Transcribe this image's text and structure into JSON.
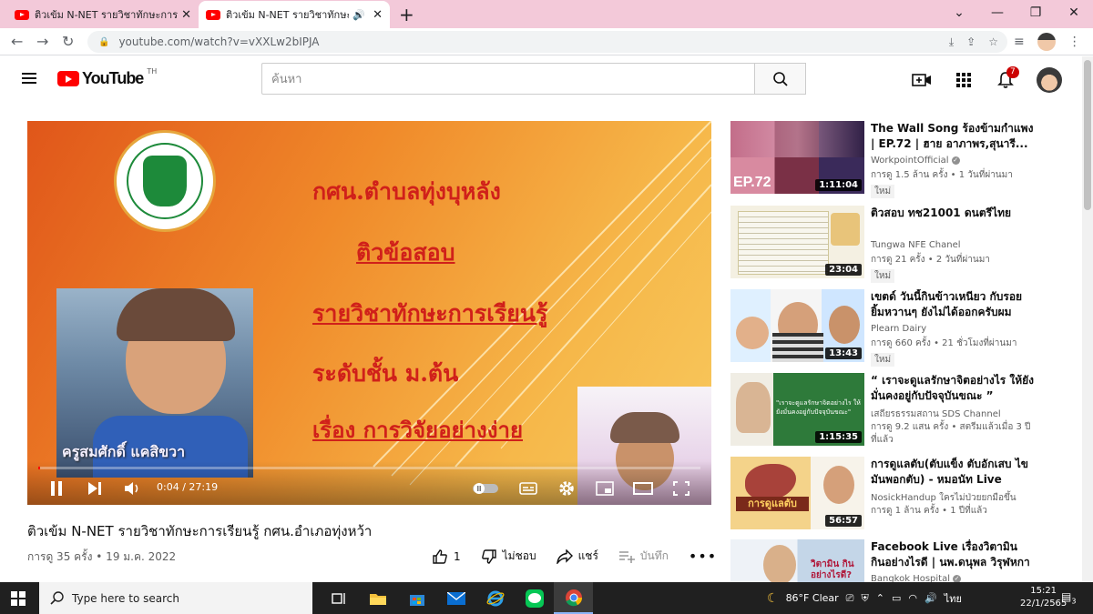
{
  "browser": {
    "tabs": [
      {
        "title": "ติวเข้ม N-NET รายวิชาทักษะการเรียนรู้",
        "active": false
      },
      {
        "title": "ติวเข้ม N-NET รายวิชาทักษะการเรี",
        "active": true
      }
    ],
    "url": "youtube.com/watch?v=vXXLw2bIPJA"
  },
  "youtube": {
    "logo_text": "YouTube",
    "country_code": "TH",
    "search_placeholder": "ค้นหา",
    "notification_count": "7"
  },
  "player": {
    "slide_lines": [
      "กศน.ตำบลทุ่งบุหลัง",
      "ติวข้อสอบ",
      "รายวิชาทักษะการเรียนรู้",
      "ระดับชั้น ม.ต้น",
      "เรื่อง การวิจัยอย่างง่าย"
    ],
    "presenter_name": "ครูสมศักดิ์ แคสิขวา",
    "time": "0:04 / 27:19",
    "progress": 0.0024
  },
  "video": {
    "title": "ติวเข้ม N-NET รายวิชาทักษะการเรียนรู้ กศน.อำเภอทุ่งหว้า",
    "meta": "การดู 35 ครั้ง • 19 ม.ค. 2022",
    "like_count": "1",
    "dislike_label": "ไม่ชอบ",
    "share_label": "แชร์",
    "save_label": "บันทึก"
  },
  "recommendations": [
    {
      "title": "The Wall Song ร้องข้ามกำแพง | EP.72 | ฮาย อาภาพร,สุนารี...",
      "channel": "WorkpointOfficial",
      "verified": true,
      "views": "การดู 1.5 ล้าน ครั้ง • 1 วันที่ผ่านมา",
      "badge": "ใหม่",
      "duration": "1:11:04",
      "thumb_text": "EP.72"
    },
    {
      "title": "ติวสอบ ทช21001 ดนตรีไทย",
      "channel": "Tungwa NFE Chanel",
      "verified": false,
      "views": "การดู 21 ครั้ง • 2 วันที่ผ่านมา",
      "badge": "ใหม่",
      "duration": "23:04",
      "thumb_text": ""
    },
    {
      "title": "เขตด์ วันนี้กินข้าวเหนียว กับรอยยิ้มหวานๆ ยังไม่ได้ออกครับผม",
      "channel": "Plearn Dairy",
      "verified": false,
      "views": "การดู 660 ครั้ง • 21 ชั่วโมงที่ผ่านมา",
      "badge": "ใหม่",
      "duration": "13:43",
      "thumb_text": ""
    },
    {
      "title": "“ เราจะดูแลรักษาจิตอย่างไร ให้ยังมั่นคงอยู่กับปัจจุบันขณะ ”",
      "channel": "เสถียรธรรมสถาน SDS Channel",
      "verified": false,
      "views": "การดู 9.2 แสน ครั้ง • สตรีมแล้วเมื่อ 3 ปีที่แล้ว",
      "badge": "",
      "duration": "1:15:35",
      "thumb_text": "\"เราจะดูแลรักษาจิตอย่างไร ให้ยังมั่นคงอยู่กับปัจจุบันขณะ\""
    },
    {
      "title": "การดูแลตับ(ตับแข็ง ตับอักเสบ ไขมันพอกตับ) - หมอนัท Live",
      "channel": "NosickHandup ใครไม่ป่วยยกมือขึ้น",
      "verified": false,
      "views": "การดู 1 ล้าน ครั้ง • 1 ปีที่แล้ว",
      "badge": "",
      "duration": "56:57",
      "thumb_text": "การดูแลตับ"
    },
    {
      "title": "Facebook Live เรื่องวิตามิน กินอย่างไรดี | นพ.ดนุพล วิรุฬหการุญ",
      "channel": "Bangkok Hospital",
      "verified": true,
      "views": "",
      "badge": "",
      "duration": "",
      "thumb_text": "วิตามิน กินอย่างไรดี?"
    }
  ],
  "taskbar": {
    "search_placeholder": "Type here to search",
    "weather": "86°F  Clear",
    "language": "ไทย",
    "time": "15:21",
    "date": "22/1/2565",
    "notification_count": "3"
  }
}
